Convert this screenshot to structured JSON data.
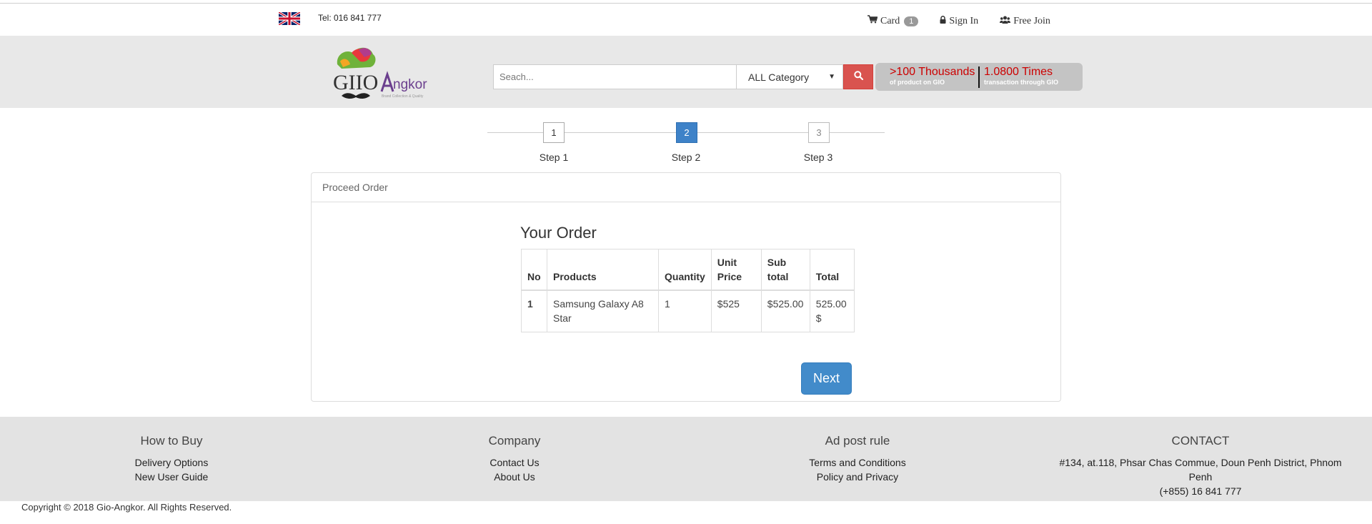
{
  "topbar": {
    "tel": "Tel: 016 841 777",
    "cart_label": "Card",
    "cart_count": "1",
    "signin_label": "Sign In",
    "join_label": "Free Join"
  },
  "header": {
    "logo_text": "GIOAngkor",
    "logo_tagline": "Brand Collection & Quality",
    "search_placeholder": "Seach...",
    "category_selected": "ALL Category",
    "stat1_big": ">100 Thousands",
    "stat1_small": "of product on GIO",
    "stat2_big": "1.0800 Times",
    "stat2_small": "transaction through GIO"
  },
  "steps": [
    {
      "num": "1",
      "label": "Step 1"
    },
    {
      "num": "2",
      "label": "Step 2"
    },
    {
      "num": "3",
      "label": "Step 3"
    }
  ],
  "panel": {
    "heading": "Proceed Order",
    "order_title": "Your Order",
    "columns": [
      "No",
      "Products",
      "Quantity",
      "Unit Price",
      "Sub total",
      "Total"
    ],
    "rows": [
      {
        "no": "1",
        "product": "Samsung Galaxy A8 Star",
        "quantity": "1",
        "unit_price": "$525",
        "sub_total": "$525.00",
        "total": "525.00 $"
      }
    ],
    "next_label": "Next"
  },
  "footer": {
    "col1": {
      "heading": "How to Buy",
      "links": [
        "Delivery Options",
        "New User Guide"
      ]
    },
    "col2": {
      "heading": "Company",
      "links": [
        "Contact Us",
        "About Us"
      ]
    },
    "col3": {
      "heading": "Ad post rule",
      "links": [
        "Terms and Conditions",
        "Policy and Privacy"
      ]
    },
    "col4": {
      "heading": "CONTACT",
      "lines": [
        "#134, at.118, Phsar Chas Commue, Doun Penh District, Phnom Penh",
        "(+855) 16 841 777"
      ]
    },
    "copyright": "Copyright © 2018 Gio-Angkor. All Rights Reserved."
  },
  "colors": {
    "accent_blue": "#428bca",
    "search_red": "#d9534f",
    "stat_red": "#cc0000",
    "header_bg": "#e8e8e8",
    "footer_bg": "#e3e3e3"
  },
  "icons": [
    "uk-flag-icon",
    "cart-icon",
    "lock-icon",
    "users-icon",
    "search-icon",
    "chevron-down-icon"
  ]
}
